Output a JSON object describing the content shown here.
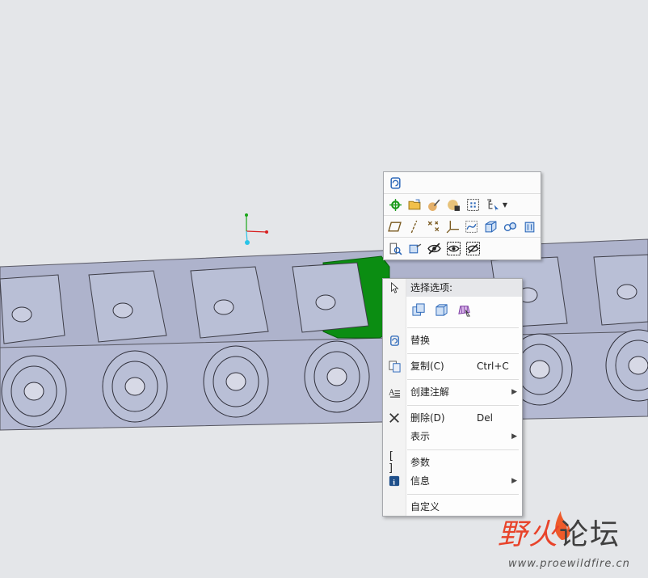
{
  "mini_toolbar": {
    "row1": [
      "replace-icon"
    ],
    "row2": [
      "datum-point-icon",
      "open-folder-icon",
      "appearance-brush-icon",
      "sphere-material-icon",
      "grid-select-icon",
      "tree-filter-icon"
    ],
    "row3": [
      "plane-icon",
      "axis-icon",
      "point-icon",
      "csys-icon",
      "curve-icon",
      "solid-box-icon",
      "assembly-icon",
      "datum-display-icon"
    ],
    "row4": [
      "view-filter-icon",
      "box-arrow-icon",
      "hide-icon",
      "show-icon",
      "hide-others-icon"
    ]
  },
  "context_menu": {
    "header": "选择选项:",
    "select_icons": [
      "select-part-icon",
      "select-body-icon",
      "select-surface-icon"
    ],
    "items": [
      {
        "label": "替换",
        "icon": "replace-icon"
      },
      {
        "label": "复制(C)",
        "shortcut": "Ctrl+C",
        "icon": "copy-icon"
      },
      {
        "label": "创建注解",
        "icon": "annotation-icon",
        "submenu": true
      },
      {
        "label": "删除(D)",
        "shortcut": "Del",
        "icon": "delete-icon"
      },
      {
        "label": "表示",
        "submenu": true
      },
      {
        "label": "参数",
        "icon": "parameters-icon"
      },
      {
        "label": "信息",
        "icon": "info-icon",
        "submenu": true
      },
      {
        "label": "自定义"
      }
    ]
  },
  "watermark": {
    "title_a": "野火",
    "title_b": "论坛",
    "url": "www.proewildfire.cn"
  },
  "colors": {
    "background": "#e4e6e9",
    "chain_face": "#b9bfd6",
    "chain_side": "#a8aec7",
    "selected_part": "#0a8a10",
    "watermark_red": "#e8432a"
  }
}
